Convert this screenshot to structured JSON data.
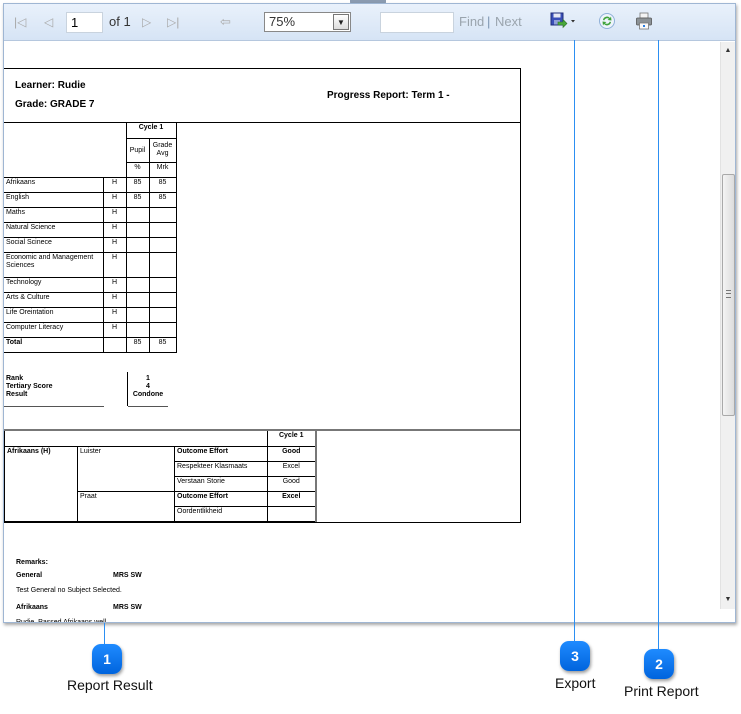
{
  "toolbar": {
    "first_page": "first-page-icon",
    "prev_page": "previous-page-icon",
    "page_value": "1",
    "of_label": "of 1",
    "next_page": "next-page-icon",
    "last_page": "last-page-icon",
    "back": "back-to-parent-icon",
    "zoom_value": "75%",
    "find_value": "",
    "find_label": "Find",
    "find_sep": "|",
    "next_label": "Next",
    "export": "export-icon",
    "refresh": "refresh-icon",
    "print": "print-icon"
  },
  "report": {
    "learner": "Learner: Rudie",
    "grade": "Grade: GRADE 7",
    "title": "Progress Report: Term 1 -",
    "marks": {
      "cycle_header": "Cycle 1",
      "pupil_header": "Pupil",
      "avg_header": "Grade Avg",
      "pupil_unit": "%",
      "avg_unit": "Mrk",
      "rows": [
        {
          "subject": "Afrikaans",
          "level": "H",
          "pupil": "85",
          "avg": "85"
        },
        {
          "subject": "English",
          "level": "H",
          "pupil": "85",
          "avg": "85"
        },
        {
          "subject": "Maths",
          "level": "H",
          "pupil": "",
          "avg": ""
        },
        {
          "subject": "Natural Science",
          "level": "H",
          "pupil": "",
          "avg": ""
        },
        {
          "subject": "Social Scinece",
          "level": "H",
          "pupil": "",
          "avg": ""
        },
        {
          "subject": "Economic and Management Sciences",
          "level": "H",
          "pupil": "",
          "avg": ""
        },
        {
          "subject": "Technology",
          "level": "H",
          "pupil": "",
          "avg": ""
        },
        {
          "subject": "Arts & Culture",
          "level": "H",
          "pupil": "",
          "avg": ""
        },
        {
          "subject": "Life Oreintation",
          "level": "H",
          "pupil": "",
          "avg": ""
        },
        {
          "subject": "Computer Literacy",
          "level": "H",
          "pupil": "",
          "avg": ""
        }
      ],
      "total_label": "Total",
      "total_pupil": "85",
      "total_avg": "85"
    },
    "summary": {
      "rank_label": "Rank",
      "rank_value": "1",
      "tertiary_label": "Tertiary Score",
      "tertiary_value": "4",
      "result_label": "Result",
      "result_value": "Condone"
    },
    "outcomes": {
      "cycle_header": "Cycle 1",
      "subject": "Afrikaans (H)",
      "groups": [
        {
          "skill": "Luister",
          "items": [
            {
              "criterion": "Outcome Effort",
              "value": "Good",
              "bold": true
            },
            {
              "criterion": "Respekteer Klasmaats",
              "value": "Excel",
              "bold": false
            },
            {
              "criterion": "Verstaan Storie",
              "value": "Good",
              "bold": false
            }
          ]
        },
        {
          "skill": "Praat",
          "items": [
            {
              "criterion": "Outcome Effort",
              "value": "Excel",
              "bold": true
            },
            {
              "criterion": "Oordentlikheid",
              "value": "",
              "bold": false
            }
          ]
        }
      ]
    },
    "remarks": {
      "title": "Remarks:",
      "entries": [
        {
          "subject": "General",
          "teacher": "MRS SW",
          "text": "Test General no Subject Selected."
        },
        {
          "subject": "Afrikaans",
          "teacher": "MRS SW",
          "text": "Rudie. Passed Afrikaans well"
        }
      ]
    }
  },
  "callouts": [
    {
      "number": "1",
      "label": "Report Result"
    },
    {
      "number": "3",
      "label": "Export"
    },
    {
      "number": "2",
      "label": "Print Report"
    }
  ],
  "colors": {
    "callout_blue": "#1078f0",
    "toolbar_bg": "#dce8f7"
  }
}
